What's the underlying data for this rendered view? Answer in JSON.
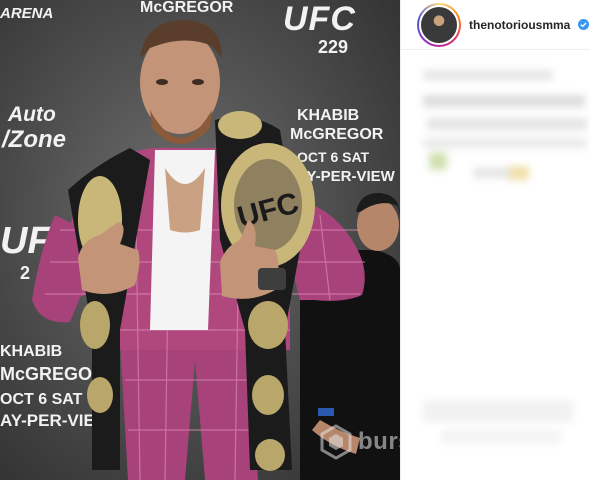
{
  "backdrop": {
    "arena": "ARENA",
    "mcgregor_top": "McGREGOR",
    "ufc_top": "UFC",
    "num_top": "229",
    "autozone_line1": "Auto",
    "autozone_line2": "/Zone",
    "khabib_right": "KHABIB",
    "mcgregor_right": "McGREGOR",
    "date_right": "OCT 6 SAT",
    "ppv_right": "AY-PER-VIEW",
    "ufc_mid": "UFC",
    "num_mid": "2",
    "khabib_left": "KHABIB",
    "mcgregor_left": "McGREGOR",
    "date_left": "OCT 6 SAT",
    "ppv_left": "AY-PER-VIEW"
  },
  "belt_text": "UFC",
  "watermark": {
    "text": "bursadabu"
  },
  "header": {
    "username": "thenotoriousmma",
    "more": "•"
  },
  "colors": {
    "verified": "#3897f0",
    "suit": "#b0487e",
    "belt_gold": "#c9b77a"
  },
  "icons": {
    "verified": "verified-badge-icon",
    "watermark_logo": "hexagon-logo-icon"
  }
}
